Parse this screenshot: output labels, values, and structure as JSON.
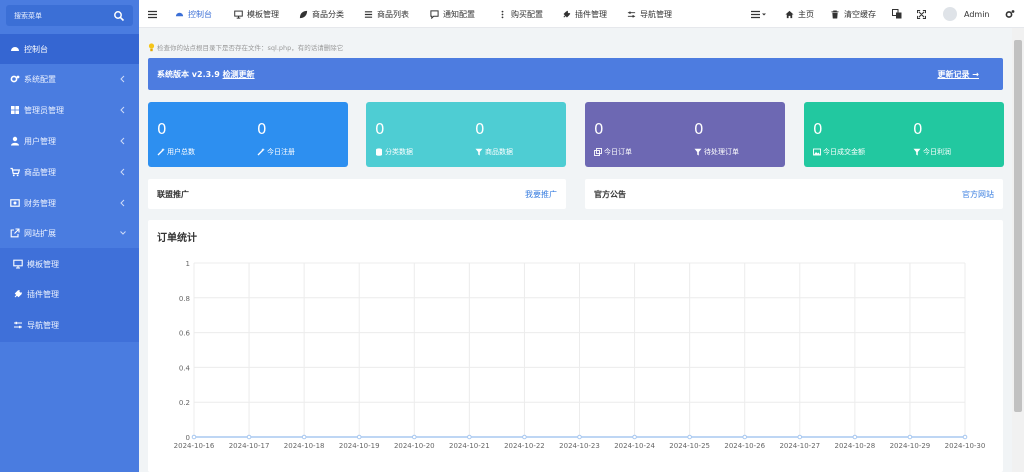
{
  "sidebar": {
    "search_placeholder": "搜索菜单",
    "items": [
      {
        "label": "控制台",
        "active": true,
        "icon": "dashboard-icon"
      },
      {
        "label": "系统配置",
        "icon": "cogs-icon"
      },
      {
        "label": "管理员管理",
        "icon": "windows-icon"
      },
      {
        "label": "用户管理",
        "icon": "user-icon"
      },
      {
        "label": "商品管理",
        "icon": "cart-icon"
      },
      {
        "label": "财务管理",
        "icon": "money-icon"
      },
      {
        "label": "网站扩展",
        "icon": "external-link-icon",
        "expanded": true
      }
    ],
    "sub_items": [
      {
        "label": "模板管理",
        "icon": "desktop-icon"
      },
      {
        "label": "插件管理",
        "icon": "plug-icon"
      },
      {
        "label": "导航管理",
        "icon": "sliders-icon"
      }
    ]
  },
  "topbar": {
    "nav": [
      {
        "label": "控制台",
        "icon": "dashboard-icon",
        "active": true
      },
      {
        "label": "模板管理",
        "icon": "desktop-icon"
      },
      {
        "label": "商品分类",
        "icon": "leaf-icon"
      },
      {
        "label": "商品列表",
        "icon": "list-icon"
      },
      {
        "label": "通知配置",
        "icon": "comment-icon"
      },
      {
        "label": "购买配置",
        "icon": "ellipsis-vertical-icon"
      },
      {
        "label": "插件管理",
        "icon": "plug-icon"
      },
      {
        "label": "导航管理",
        "icon": "sliders-icon"
      }
    ],
    "home": "主页",
    "clear_cache": "清空缓存",
    "user": "Admin"
  },
  "notice": "检查你的站点根目录下是否存在文件：sql.php，有的话请删除它",
  "version": {
    "prefix": "系统版本 v2.3.9 ",
    "check": "检测更新",
    "changelog": "更新记录 →"
  },
  "stats": [
    {
      "color": "#2d8ff0",
      "items": [
        {
          "value": "0",
          "label": "用户总数",
          "icon": "magic-icon"
        },
        {
          "value": "0",
          "label": "今日注册",
          "icon": "magic-icon"
        }
      ]
    },
    {
      "color": "#4ecdd3",
      "items": [
        {
          "value": "0",
          "label": "分类数据",
          "icon": "database-icon"
        },
        {
          "value": "0",
          "label": "商品数据",
          "icon": "filter-icon"
        }
      ]
    },
    {
      "color": "#6d68b3",
      "items": [
        {
          "value": "0",
          "label": "今日订单",
          "icon": "clone-icon"
        },
        {
          "value": "0",
          "label": "待处理订单",
          "icon": "filter-icon"
        }
      ]
    },
    {
      "color": "#22c8a0",
      "items": [
        {
          "value": "0",
          "label": "今日成交金额",
          "icon": "picture-icon"
        },
        {
          "value": "0",
          "label": "今日利润",
          "icon": "filter-icon"
        }
      ]
    }
  ],
  "panels": {
    "affiliate": {
      "title": "联盟推广",
      "link": "我要推广"
    },
    "announcement": {
      "title": "官方公告",
      "link": "官方网站"
    }
  },
  "chart_title": "订单统计",
  "colors": {
    "sidebar": "#4a7ce0",
    "accent": "#3b6fd6",
    "link": "#3b7fe0",
    "line": "#a8c8f0"
  },
  "chart_data": {
    "type": "line",
    "title": "订单统计",
    "x": [
      "2024-10-16",
      "2024-10-17",
      "2024-10-18",
      "2024-10-19",
      "2024-10-20",
      "2024-10-21",
      "2024-10-22",
      "2024-10-23",
      "2024-10-24",
      "2024-10-25",
      "2024-10-26",
      "2024-10-27",
      "2024-10-28",
      "2024-10-29",
      "2024-10-30"
    ],
    "series": [
      {
        "values": [
          0,
          0,
          0,
          0,
          0,
          0,
          0,
          0,
          0,
          0,
          0,
          0,
          0,
          0,
          0
        ]
      }
    ],
    "ylim": [
      0,
      1
    ],
    "yticks": [
      "0",
      "0.2",
      "0.4",
      "0.6",
      "0.8",
      "1"
    ],
    "grid": true
  }
}
